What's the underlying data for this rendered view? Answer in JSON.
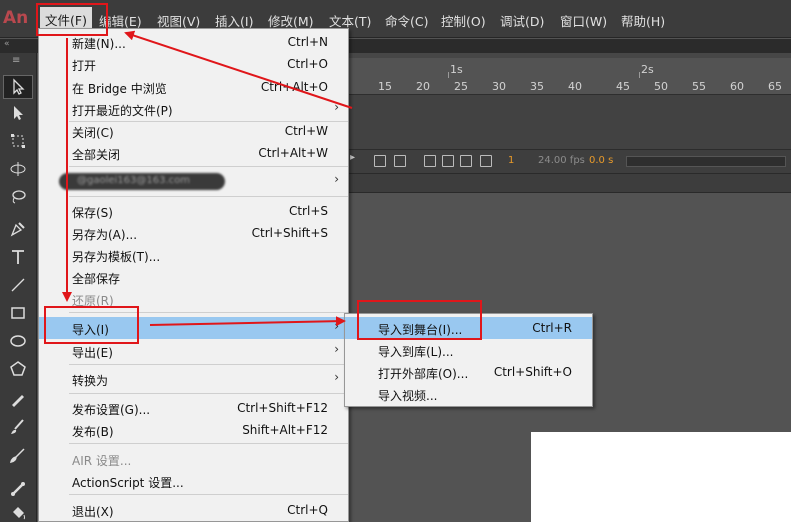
{
  "app": {
    "logo": "An"
  },
  "menubar": {
    "items": [
      {
        "label": "文件(F)",
        "active": true
      },
      {
        "label": "编辑(E)"
      },
      {
        "label": "视图(V)"
      },
      {
        "label": "插入(I)"
      },
      {
        "label": "修改(M)"
      },
      {
        "label": "文本(T)"
      },
      {
        "label": "命令(C)"
      },
      {
        "label": "控制(O)"
      },
      {
        "label": "调试(D)"
      },
      {
        "label": "窗口(W)"
      },
      {
        "label": "帮助(H)"
      }
    ]
  },
  "file_menu": {
    "items": [
      {
        "label": "新建(N)...",
        "shortcut": "Ctrl+N"
      },
      {
        "label": "打开",
        "shortcut": "Ctrl+O"
      },
      {
        "label": "在 Bridge 中浏览",
        "shortcut": "Ctrl+Alt+O"
      },
      {
        "label": "打开最近的文件(P)",
        "shortcut": "",
        "submenu": true
      },
      {
        "label": "关闭(C)",
        "shortcut": "Ctrl+W"
      },
      {
        "label": "全部关闭",
        "shortcut": "Ctrl+Alt+W"
      },
      {
        "label": "@gaolei163@163.com",
        "shortcut": "",
        "submenu": true
      },
      {
        "label": "保存(S)",
        "shortcut": "Ctrl+S"
      },
      {
        "label": "另存为(A)...",
        "shortcut": "Ctrl+Shift+S"
      },
      {
        "label": "另存为模板(T)...",
        "shortcut": ""
      },
      {
        "label": "全部保存",
        "shortcut": ""
      },
      {
        "label": "还原(R)",
        "shortcut": "",
        "disabled": true
      },
      {
        "label": "导入(I)",
        "shortcut": "",
        "submenu": true,
        "highlighted": true
      },
      {
        "label": "导出(E)",
        "shortcut": "",
        "submenu": true
      },
      {
        "label": "转换为",
        "shortcut": "",
        "submenu": true
      },
      {
        "label": "发布设置(G)...",
        "shortcut": "Ctrl+Shift+F12"
      },
      {
        "label": "发布(B)",
        "shortcut": "Shift+Alt+F12"
      },
      {
        "label": "AIR 设置...",
        "shortcut": "",
        "disabled": true
      },
      {
        "label": "ActionScript 设置...",
        "shortcut": ""
      },
      {
        "label": "退出(X)",
        "shortcut": "Ctrl+Q"
      }
    ]
  },
  "import_submenu": {
    "items": [
      {
        "label": "导入到舞台(I)...",
        "shortcut": "Ctrl+R",
        "highlighted": true
      },
      {
        "label": "导入到库(L)...",
        "shortcut": ""
      },
      {
        "label": "打开外部库(O)...",
        "shortcut": "Ctrl+Shift+O"
      },
      {
        "label": "导入视频...",
        "shortcut": ""
      }
    ]
  },
  "timeline": {
    "seconds": [
      "1s",
      "2s"
    ],
    "frame_numbers": [
      "15",
      "20",
      "25",
      "30",
      "35",
      "40",
      "45",
      "50",
      "55",
      "60",
      "65"
    ],
    "current_frame": "1",
    "fps": "24.00 fps",
    "elapsed": "0.0 s"
  },
  "toolbar": {
    "tools": [
      "selection-tool-icon",
      "subselection-tool-icon",
      "free-transform-tool-icon",
      "3d-rotation-tool-icon",
      "lasso-tool-icon",
      "pen-tool-icon",
      "text-tool-icon",
      "line-tool-icon",
      "rectangle-tool-icon",
      "oval-tool-icon",
      "polystar-tool-icon",
      "pencil-tool-icon",
      "paint-brush-tool-icon",
      "brush-tool-icon",
      "bone-tool-icon",
      "paint-bucket-tool-icon"
    ]
  },
  "colors": {
    "highlight": "#99c8f0",
    "annotation": "#e0161a",
    "menu_bg": "#f1f1f1",
    "logo": "#b9484e"
  }
}
